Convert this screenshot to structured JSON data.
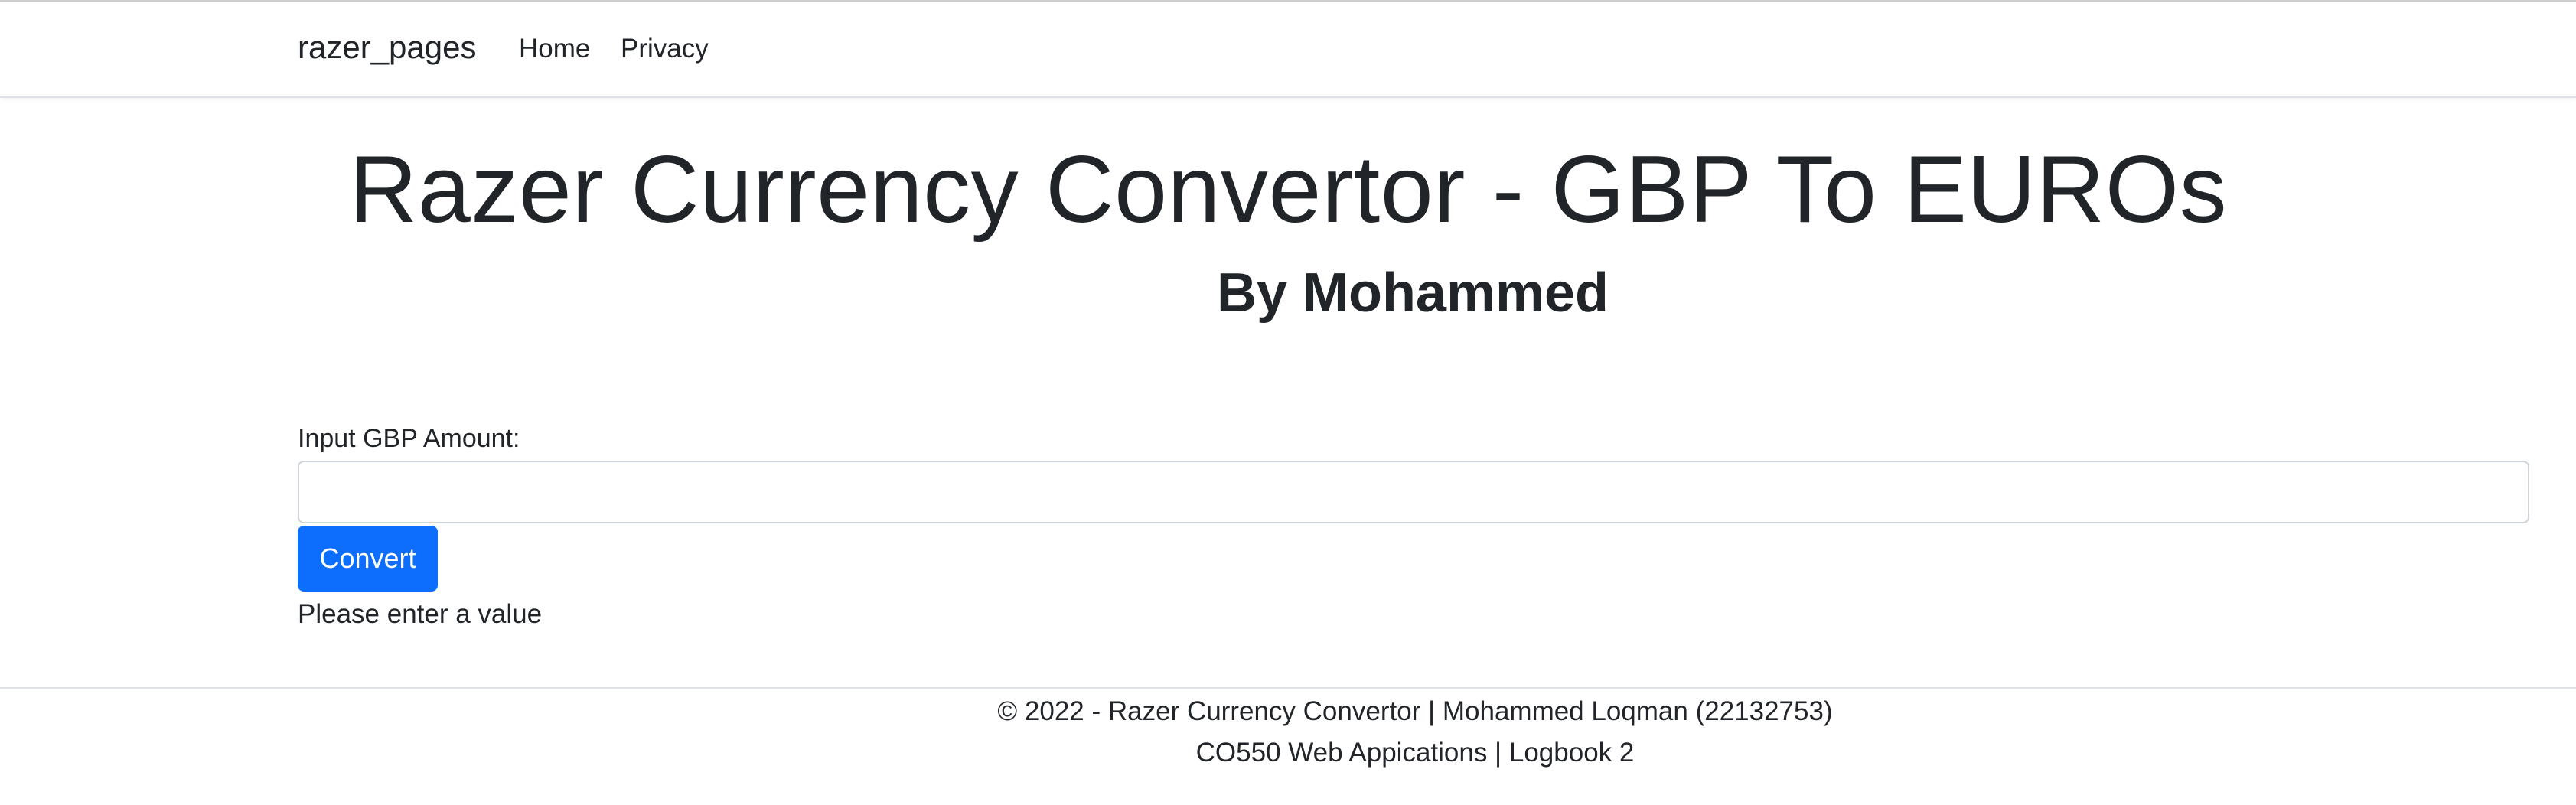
{
  "navbar": {
    "brand": "razer_pages",
    "links": [
      {
        "label": "Home"
      },
      {
        "label": "Privacy"
      }
    ]
  },
  "main": {
    "title": "Razer Currency Convertor - GBP To EUROs",
    "subtitle": "By Mohammed",
    "form": {
      "label": "Input GBP Amount:",
      "input_value": "",
      "button_label": "Convert"
    },
    "message": "Please enter a value"
  },
  "footer": {
    "line1": "© 2022 - Razer Currency Convertor | Mohammed Loqman (22132753)",
    "line2": "CO550 Web Appications | Logbook 2"
  },
  "colors": {
    "primary_button": "#0d6efd",
    "text": "#212529",
    "border": "#dee2e6"
  }
}
